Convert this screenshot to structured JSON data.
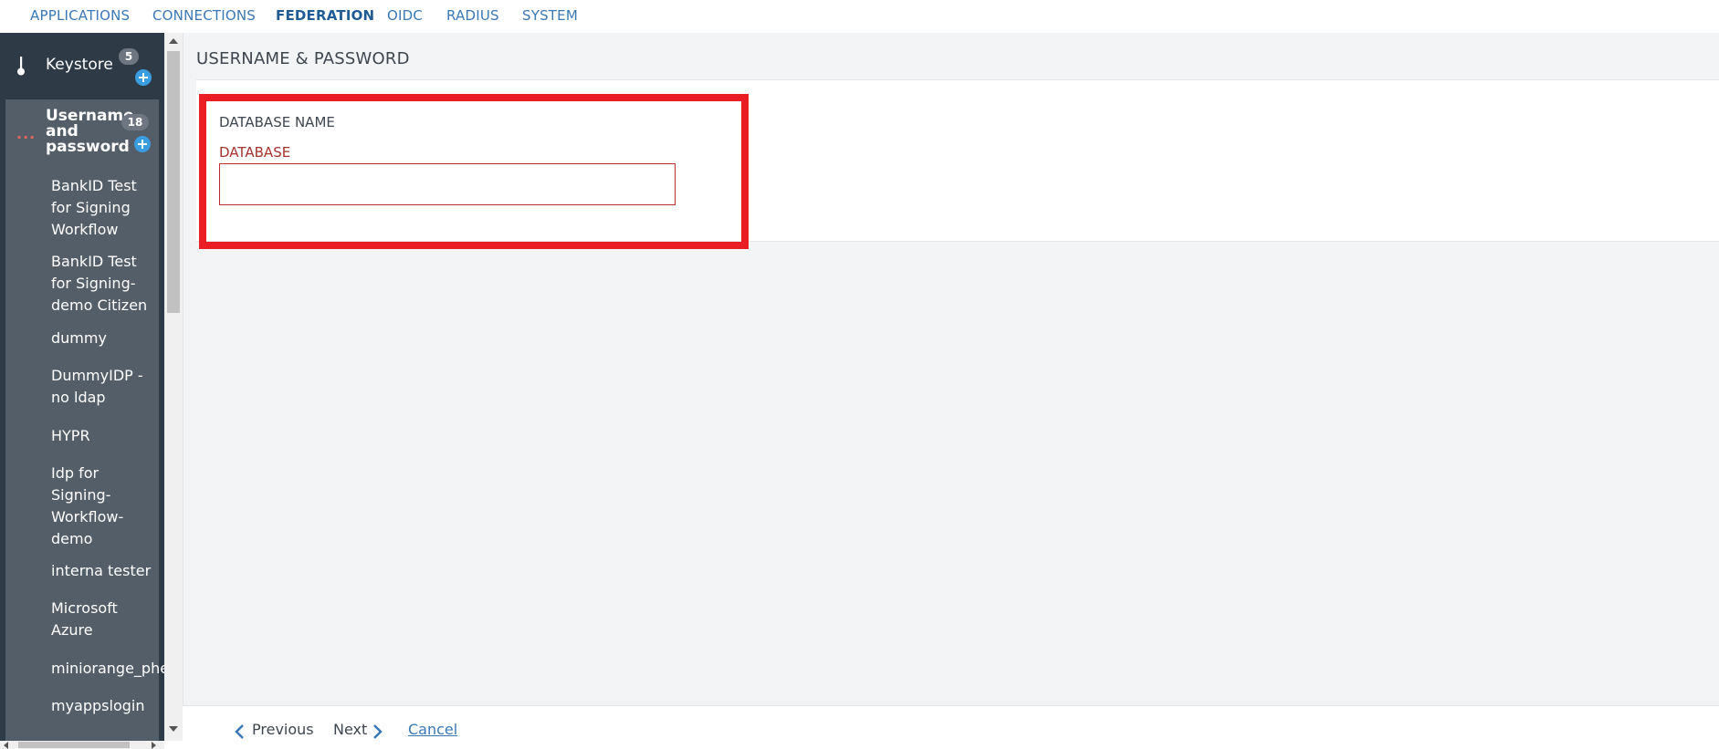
{
  "topnav": {
    "tabs": [
      {
        "label": "APPLICATIONS",
        "active": false
      },
      {
        "label": "CONNECTIONS",
        "active": false
      },
      {
        "label": "FEDERATION",
        "active": true
      },
      {
        "label": "OIDC",
        "active": false
      },
      {
        "label": "RADIUS",
        "active": false
      },
      {
        "label": "SYSTEM",
        "active": false
      }
    ]
  },
  "sidebar": {
    "keystore": {
      "label": "Keystore",
      "count": "5",
      "icon": "key-icon"
    },
    "group": {
      "title": "Username and password",
      "count": "18",
      "items": [
        "BankID Test for Signing Workflow",
        "BankID Test for Signing-demo Citizen",
        "dummy",
        "DummyIDP - no ldap",
        "HYPR",
        "Idp for Signing-Workflow-demo",
        "interna tester",
        "Microsoft Azure",
        "miniorange_phen",
        "myappslogin"
      ]
    }
  },
  "main": {
    "page_title": "USERNAME & PASSWORD",
    "section_label": "DATABASE NAME",
    "field_label": "DATABASE",
    "field_value": ""
  },
  "footer": {
    "previous_label": "Previous",
    "next_label": "Next",
    "cancel_label": "Cancel"
  },
  "colors": {
    "accent": "#3a78b5",
    "sidebar_bg": "#2e3a46",
    "highlight": "#ea1d24",
    "error": "#a3332c"
  }
}
